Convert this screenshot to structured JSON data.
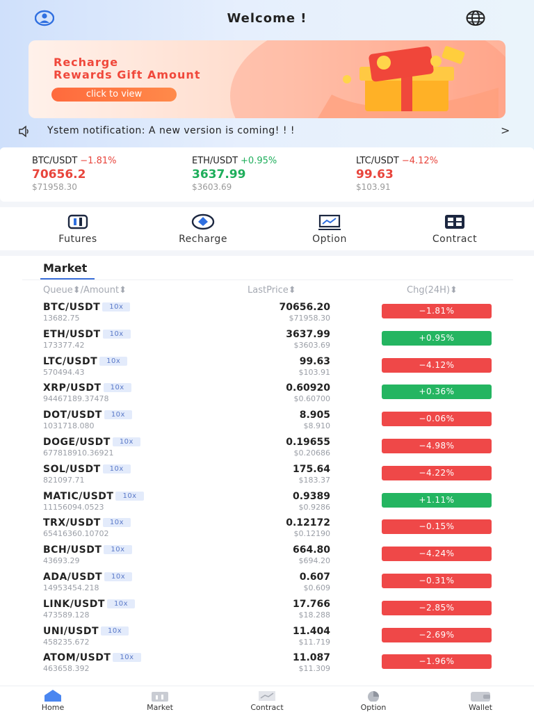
{
  "header": {
    "title": "Welcome !",
    "user_icon": "user-icon",
    "globe_icon": "globe-icon"
  },
  "banner": {
    "line1": "Recharge",
    "line2": "Rewards Gift Amount",
    "cta": "click to view"
  },
  "notice": {
    "text": "Ystem notification: A new version is coming! ! !",
    "chevron": ">"
  },
  "tickers": [
    {
      "pair": "BTC/USDT",
      "chg": "−1.81%",
      "price": "70656.2",
      "usd": "$71958.30",
      "dir": "down"
    },
    {
      "pair": "ETH/USDT",
      "chg": "+0.95%",
      "price": "3637.99",
      "usd": "$3603.69",
      "dir": "up"
    },
    {
      "pair": "LTC/USDT",
      "chg": "−4.12%",
      "price": "99.63",
      "usd": "$103.91",
      "dir": "down"
    }
  ],
  "quick": [
    {
      "label": "Futures",
      "icon": "futures-icon"
    },
    {
      "label": "Recharge",
      "icon": "recharge-icon"
    },
    {
      "label": "Option",
      "icon": "option-icon"
    },
    {
      "label": "Contract",
      "icon": "contract-icon"
    }
  ],
  "market": {
    "tab": "Market",
    "col_queue": "Queue⬍/Amount⬍",
    "col_last": "LastPrice⬍",
    "col_chg": "Chg(24H)⬍",
    "rows": [
      {
        "sym": "BTC/USDT",
        "lev": "10x",
        "amount": "13682.75",
        "last": "70656.20",
        "usd": "$71958.30",
        "chg": "−1.81%",
        "dir": "down"
      },
      {
        "sym": "ETH/USDT",
        "lev": "10x",
        "amount": "173377.42",
        "last": "3637.99",
        "usd": "$3603.69",
        "chg": "+0.95%",
        "dir": "up"
      },
      {
        "sym": "LTC/USDT",
        "lev": "10x",
        "amount": "570494.43",
        "last": "99.63",
        "usd": "$103.91",
        "chg": "−4.12%",
        "dir": "down"
      },
      {
        "sym": "XRP/USDT",
        "lev": "10x",
        "amount": "94467189.37478",
        "last": "0.60920",
        "usd": "$0.60700",
        "chg": "+0.36%",
        "dir": "up"
      },
      {
        "sym": "DOT/USDT",
        "lev": "10x",
        "amount": "1031718.080",
        "last": "8.905",
        "usd": "$8.910",
        "chg": "−0.06%",
        "dir": "down"
      },
      {
        "sym": "DOGE/USDT",
        "lev": "10x",
        "amount": "677818910.36921",
        "last": "0.19655",
        "usd": "$0.20686",
        "chg": "−4.98%",
        "dir": "down"
      },
      {
        "sym": "SOL/USDT",
        "lev": "10x",
        "amount": "821097.71",
        "last": "175.64",
        "usd": "$183.37",
        "chg": "−4.22%",
        "dir": "down"
      },
      {
        "sym": "MATIC/USDT",
        "lev": "10x",
        "amount": "11156094.0523",
        "last": "0.9389",
        "usd": "$0.9286",
        "chg": "+1.11%",
        "dir": "up"
      },
      {
        "sym": "TRX/USDT",
        "lev": "10x",
        "amount": "65416360.10702",
        "last": "0.12172",
        "usd": "$0.12190",
        "chg": "−0.15%",
        "dir": "down"
      },
      {
        "sym": "BCH/USDT",
        "lev": "10x",
        "amount": "43693.29",
        "last": "664.80",
        "usd": "$694.20",
        "chg": "−4.24%",
        "dir": "down"
      },
      {
        "sym": "ADA/USDT",
        "lev": "10x",
        "amount": "14953454.218",
        "last": "0.607",
        "usd": "$0.609",
        "chg": "−0.31%",
        "dir": "down"
      },
      {
        "sym": "LINK/USDT",
        "lev": "10x",
        "amount": "473589.128",
        "last": "17.766",
        "usd": "$18.288",
        "chg": "−2.85%",
        "dir": "down"
      },
      {
        "sym": "UNI/USDT",
        "lev": "10x",
        "amount": "458235.672",
        "last": "11.404",
        "usd": "$11.719",
        "chg": "−2.69%",
        "dir": "down"
      },
      {
        "sym": "ATOM/USDT",
        "lev": "10x",
        "amount": "463658.392",
        "last": "11.087",
        "usd": "$11.309",
        "chg": "−1.96%",
        "dir": "down"
      }
    ]
  },
  "tabbar": [
    {
      "label": "Home",
      "icon": "home-icon",
      "active": true
    },
    {
      "label": "Market",
      "icon": "market-icon",
      "active": false
    },
    {
      "label": "Contract",
      "icon": "contract-chart-icon",
      "active": false
    },
    {
      "label": "Option",
      "icon": "option-pie-icon",
      "active": false
    },
    {
      "label": "Wallet",
      "icon": "wallet-icon",
      "active": false
    }
  ],
  "colors": {
    "up": "#1eae5b",
    "down": "#e8453c",
    "accent": "#3a6fd8"
  }
}
